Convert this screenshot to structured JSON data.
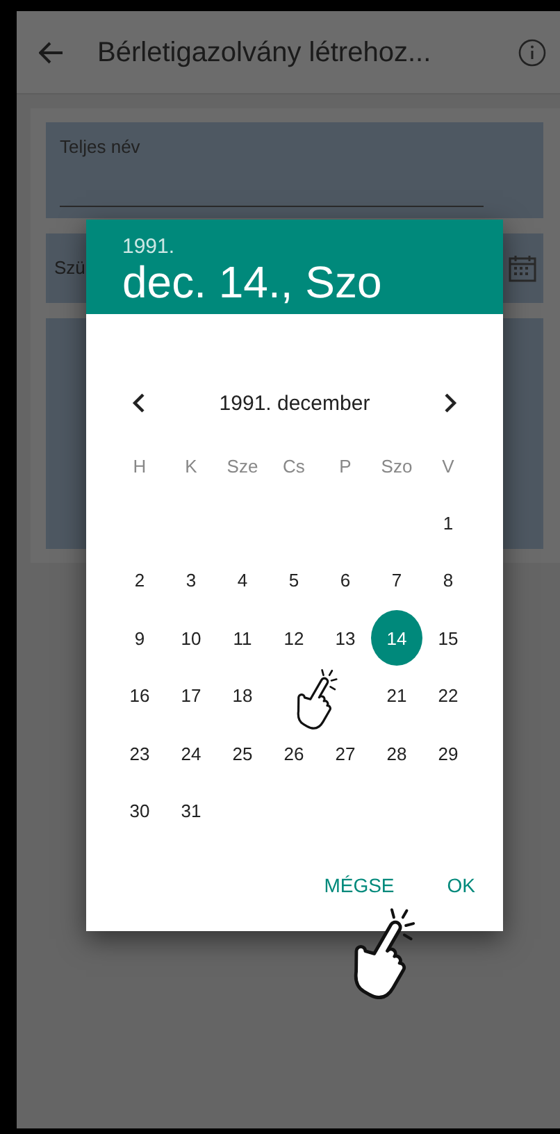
{
  "app_bar": {
    "title": "Bérletigazolvány létrehoz..."
  },
  "form": {
    "fields": [
      {
        "kind": "text",
        "label": "Teljes név"
      },
      {
        "kind": "date",
        "label": "Szü"
      },
      {
        "kind": "blank"
      }
    ]
  },
  "date_dialog": {
    "year": "1991.",
    "date": "dec. 14., Szo",
    "month": "1991. december",
    "weekdays": [
      "H",
      "K",
      "Sze",
      "Cs",
      "P",
      "Szo",
      "V"
    ],
    "weeks": [
      [
        {
          "label": "1",
          "selected": false
        }
      ],
      [
        {
          "label": "2",
          "selected": false
        },
        {
          "label": "3",
          "selected": false
        },
        {
          "label": "4",
          "selected": false
        },
        {
          "label": "5",
          "selected": false
        },
        {
          "label": "6",
          "selected": false
        },
        {
          "label": "7",
          "selected": false
        },
        {
          "label": "8",
          "selected": false
        }
      ],
      [
        {
          "label": "9",
          "selected": false
        },
        {
          "label": "10",
          "selected": false
        },
        {
          "label": "11",
          "selected": false
        },
        {
          "label": "12",
          "selected": false
        },
        {
          "label": "13",
          "selected": false
        },
        {
          "label": "14",
          "selected": true
        },
        {
          "label": "15",
          "selected": false
        }
      ],
      [
        {
          "label": "16",
          "selected": false
        },
        {
          "label": "17",
          "selected": false
        },
        {
          "label": "18",
          "selected": false
        },
        {
          "kind": "covered"
        },
        {
          "kind": "covered"
        },
        {
          "label": "21",
          "selected": false
        },
        {
          "label": "22",
          "selected": false
        }
      ],
      [
        {
          "label": "23",
          "selected": false
        },
        {
          "label": "24",
          "selected": false
        },
        {
          "label": "25",
          "selected": false
        },
        {
          "label": "26",
          "selected": false
        },
        {
          "label": "27",
          "selected": false
        },
        {
          "label": "28",
          "selected": false
        },
        {
          "label": "29",
          "selected": false
        }
      ],
      [
        {
          "label": "30",
          "selected": false
        },
        {
          "label": "31",
          "selected": false
        }
      ]
    ],
    "buttons": [
      "MÉGSE",
      "OK"
    ]
  }
}
